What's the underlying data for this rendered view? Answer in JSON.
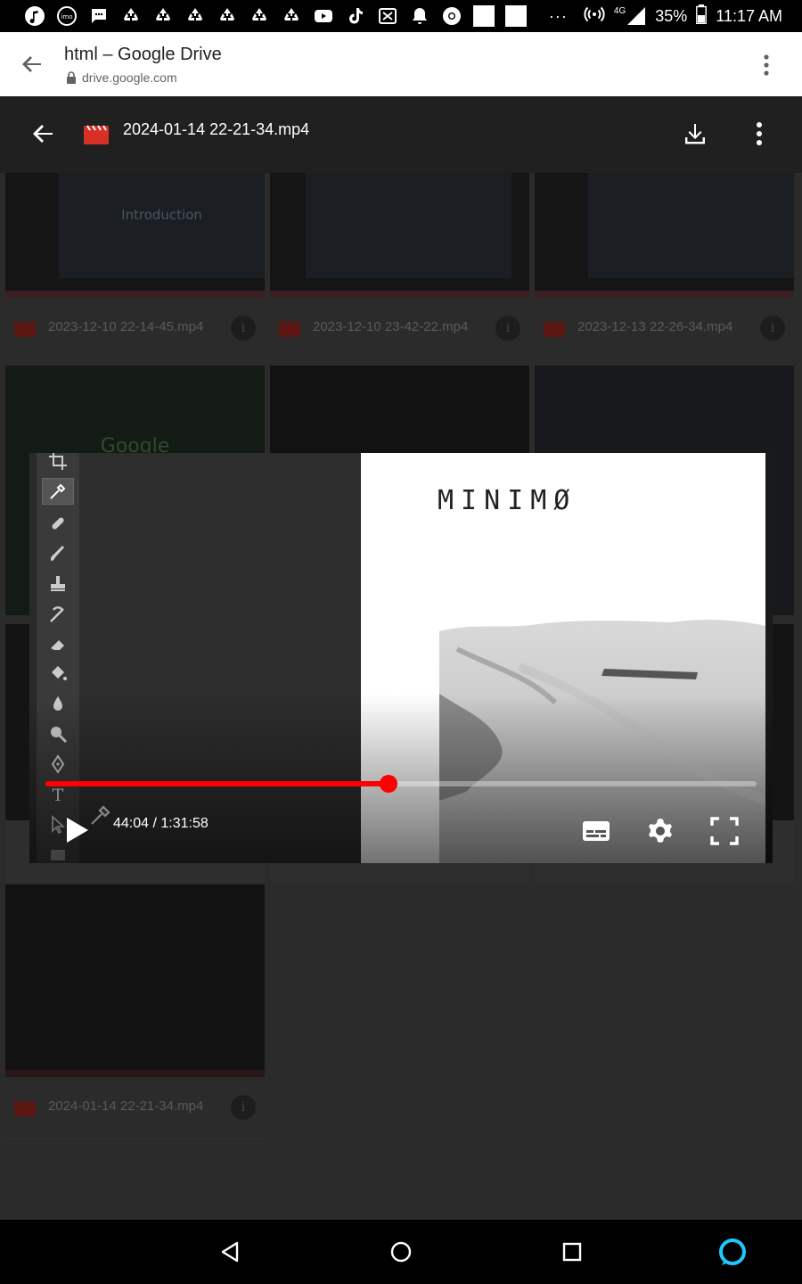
{
  "status_bar": {
    "more_indicator": "···",
    "network": "4G",
    "battery": "35%",
    "time": "11:17 AM",
    "notification_icons": [
      "music-icon",
      "imo-icon",
      "message-icon",
      "recycle-icon",
      "recycle-icon",
      "recycle-icon",
      "recycle-icon",
      "recycle-icon",
      "recycle-icon",
      "youtube-icon",
      "tiktok-icon",
      "capcut-icon",
      "bell-icon",
      "chrome-icon",
      "white-square-icon",
      "white-square-icon"
    ]
  },
  "browser": {
    "title": "html – Google Drive",
    "url": "drive.google.com"
  },
  "viewer": {
    "file_name": "2024-01-14 22-21-34.mp4"
  },
  "files": [
    {
      "name": "2023-12-10 22-14-45.mp4",
      "thumb_text": "Introduction"
    },
    {
      "name": "2023-12-10 23-42-22.mp4",
      "thumb_text": ""
    },
    {
      "name": "2023-12-13 22-26-34.mp4",
      "thumb_text": ""
    },
    {
      "name": "",
      "thumb_text": "Google"
    },
    {
      "name": "",
      "thumb_text": ""
    },
    {
      "name": "",
      "thumb_text": ""
    },
    {
      "name": "2024-01-14 22-21-34.mp4",
      "thumb_text": ""
    }
  ],
  "info_glyph": "i",
  "player": {
    "overlay_text": "MINIMØ",
    "time_display": "44:04 / 1:31:58",
    "progress_fraction": 0.482
  },
  "colors": {
    "progress": "#ff0000",
    "file_icon_red": "#d93025",
    "assistant_ring": "#1ec8ff"
  }
}
